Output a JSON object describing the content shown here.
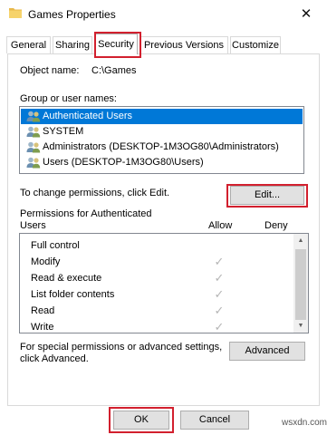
{
  "window": {
    "title": "Games Properties",
    "close_glyph": "✕",
    "icon": "folder-icon"
  },
  "tabs": [
    {
      "label": "General"
    },
    {
      "label": "Sharing"
    },
    {
      "label": "Security",
      "active": true
    },
    {
      "label": "Previous Versions"
    },
    {
      "label": "Customize"
    }
  ],
  "security": {
    "object_name_label": "Object name:",
    "object_name_value": "C:\\Games",
    "group_label": "Group or user names:",
    "users": [
      {
        "name": "Authenticated Users",
        "selected": true,
        "icon": "users-icon"
      },
      {
        "name": "SYSTEM",
        "icon": "users-icon"
      },
      {
        "name": "Administrators (DESKTOP-1M3OG80\\Administrators)",
        "icon": "users-icon"
      },
      {
        "name": "Users (DESKTOP-1M3OG80\\Users)",
        "icon": "users-icon"
      }
    ],
    "change_text": "To change permissions, click Edit.",
    "edit_button": "Edit...",
    "permissions_label_line1": "Permissions for Authenticated",
    "permissions_label_line2": "Users",
    "allow_header": "Allow",
    "deny_header": "Deny",
    "permissions": [
      {
        "name": "Full control",
        "allow": false
      },
      {
        "name": "Modify",
        "allow": true
      },
      {
        "name": "Read & execute",
        "allow": true
      },
      {
        "name": "List folder contents",
        "allow": true
      },
      {
        "name": "Read",
        "allow": true
      },
      {
        "name": "Write",
        "allow": true
      }
    ],
    "special_text_line1": "For special permissions or advanced settings,",
    "special_text_line2": "click Advanced.",
    "advanced_button": "Advanced"
  },
  "footer": {
    "ok": "OK",
    "cancel": "Cancel"
  },
  "watermark": "wsxdn.com",
  "colors": {
    "selection": "#0078d7",
    "highlight_box": "#d2202e",
    "check": "#b5b5b5"
  }
}
